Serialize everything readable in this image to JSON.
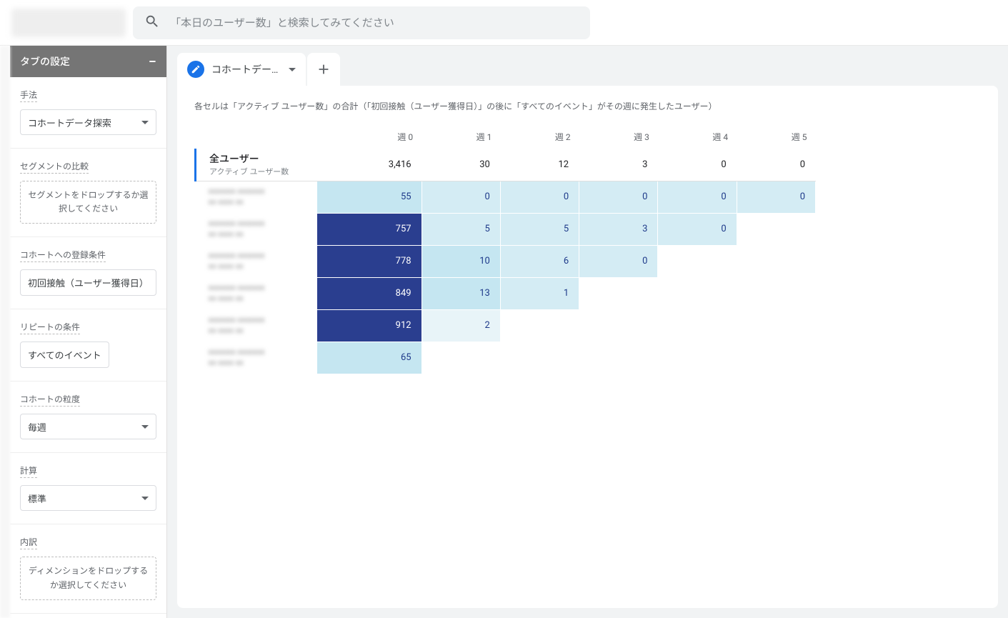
{
  "header": {
    "search_placeholder": "「本日のユーザー数」と検索してみてください"
  },
  "sidebar": {
    "title": "タブの設定",
    "method": {
      "label": "手法",
      "value": "コホートデータ探索"
    },
    "segment": {
      "label": "セグメントの比較",
      "drop_text": "セグメントをドロップするか選択してください"
    },
    "inclusion": {
      "label": "コホートへの登録条件",
      "value": "初回接触（ユーザー獲得日）"
    },
    "return": {
      "label": "リピートの条件",
      "value": "すべてのイベント"
    },
    "granularity": {
      "label": "コホートの粒度",
      "value": "毎週"
    },
    "calculation": {
      "label": "計算",
      "value": "標準"
    },
    "breakdown": {
      "label": "内訳",
      "drop_text": "ディメンションをドロップするか選択してください"
    }
  },
  "tab": {
    "label": "コホートデー…"
  },
  "description": "各セルは「アクティブ ユーザー数」の合計（「初回接触（ユーザー獲得日）」の後に「すべてのイベント」がその週に発生したユーザー）",
  "cohort": {
    "columns": [
      "週 0",
      "週 1",
      "週 2",
      "週 3",
      "週 4",
      "週 5"
    ],
    "summary": {
      "title": "全ユーザー",
      "subtitle": "アクティブ ユーザー数",
      "values": [
        "3,416",
        "30",
        "12",
        "3",
        "0",
        "0"
      ]
    },
    "rows": [
      {
        "values": [
          "55",
          "0",
          "0",
          "0",
          "0",
          "0"
        ],
        "shades": [
          "shade-1",
          "shade-0",
          "shade-0",
          "shade-0",
          "shade-0",
          "shade-0"
        ]
      },
      {
        "values": [
          "757",
          "5",
          "5",
          "3",
          "0",
          ""
        ],
        "shades": [
          "shade-dark",
          "shade-0",
          "shade-0",
          "shade-0",
          "shade-0",
          ""
        ]
      },
      {
        "values": [
          "778",
          "10",
          "6",
          "0",
          "",
          ""
        ],
        "shades": [
          "shade-dark",
          "shade-1",
          "shade-0",
          "shade-0",
          "",
          ""
        ]
      },
      {
        "values": [
          "849",
          "13",
          "1",
          "",
          "",
          ""
        ],
        "shades": [
          "shade-dark",
          "shade-1",
          "shade-0",
          "",
          "",
          ""
        ]
      },
      {
        "values": [
          "912",
          "2",
          "",
          "",
          "",
          ""
        ],
        "shades": [
          "shade-dark",
          "shade-light",
          "",
          "",
          "",
          ""
        ]
      },
      {
        "values": [
          "65",
          "",
          "",
          "",
          "",
          ""
        ],
        "shades": [
          "shade-1",
          "",
          "",
          "",
          "",
          ""
        ]
      }
    ]
  },
  "chart_data": {
    "type": "table",
    "title": "コホートデータ探索 — アクティブ ユーザー数（毎週）",
    "columns": [
      "週 0",
      "週 1",
      "週 2",
      "週 3",
      "週 4",
      "週 5"
    ],
    "summary_row": {
      "label": "全ユーザー",
      "values": [
        3416,
        30,
        12,
        3,
        0,
        0
      ]
    },
    "cohorts": [
      [
        55,
        0,
        0,
        0,
        0,
        0
      ],
      [
        757,
        5,
        5,
        3,
        0,
        null
      ],
      [
        778,
        10,
        6,
        0,
        null,
        null
      ],
      [
        849,
        13,
        1,
        null,
        null,
        null
      ],
      [
        912,
        2,
        null,
        null,
        null,
        null
      ],
      [
        65,
        null,
        null,
        null,
        null,
        null
      ]
    ]
  }
}
